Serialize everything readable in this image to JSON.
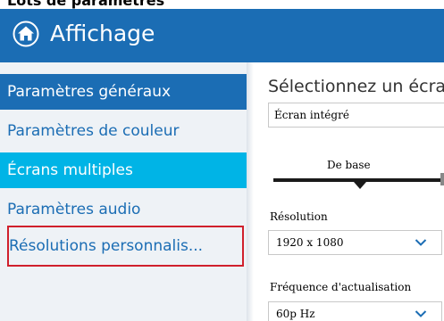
{
  "top_strip": {
    "text": "Lots de parametres"
  },
  "header": {
    "title": "Affichage",
    "home_icon": "home-icon",
    "background": "#1b6db4"
  },
  "sidebar": {
    "items": [
      {
        "label": "Paramètres généraux",
        "state": "active"
      },
      {
        "label": "Paramètres de couleur",
        "state": "normal"
      },
      {
        "label": "Écrans multiples",
        "state": "highlight"
      },
      {
        "label": "Paramètres audio",
        "state": "normal"
      },
      {
        "label": "Résolutions personnalis...",
        "state": "outlined"
      }
    ],
    "active_color": "#1b6db4",
    "highlight_color": "#00b4e6",
    "outline_color": "#d0202c"
  },
  "main": {
    "title": "Sélectionnez un écran",
    "screen_select": {
      "value": "Écran intégré"
    },
    "mode_slider": {
      "label": "De base"
    },
    "resolution": {
      "label": "Résolution",
      "value": "1920 x 1080",
      "icon": "chevron-down-icon"
    },
    "refresh_rate": {
      "label": "Fréquence d'actualisation",
      "value": "60p Hz",
      "icon": "chevron-down-icon"
    }
  }
}
